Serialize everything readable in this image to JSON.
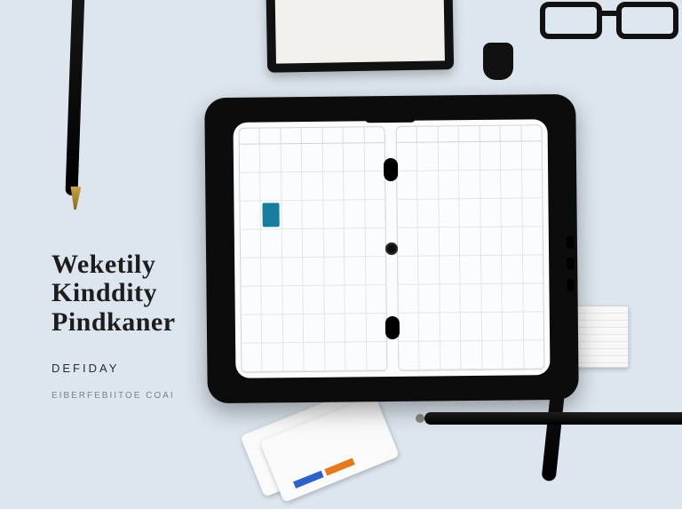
{
  "title": {
    "line1": "Weketily",
    "line2": "Kinddity",
    "line3": "Pindkaner"
  },
  "subtitle": "DEFIDAY",
  "credit": "EIBERFEBIITOE COAI",
  "planner": {
    "left": {
      "header_cols": 7,
      "rows": 8,
      "cols": 7,
      "highlight": {
        "row": 2,
        "col": 1,
        "color": "#167e9e"
      }
    },
    "right": {
      "header_cols": 7,
      "rows": 8,
      "cols": 7
    }
  }
}
